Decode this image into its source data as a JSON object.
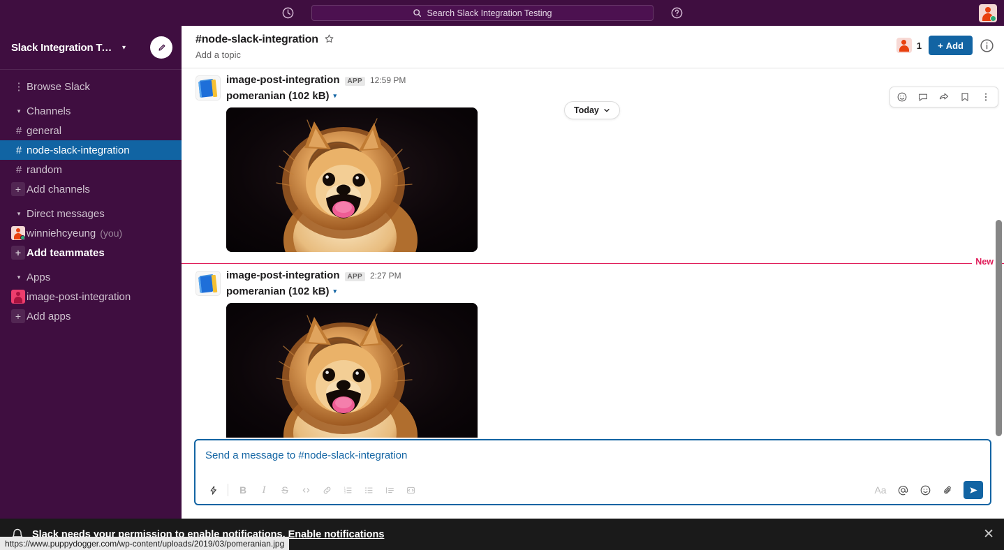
{
  "topbar": {
    "history_icon": "clock-icon",
    "search_placeholder": "Search Slack Integration Testing",
    "search_icon": "search-icon",
    "help_icon": "help-circle-icon",
    "avatar_icon": "user-avatar"
  },
  "sidebar": {
    "workspace_name": "Slack Integration Testi...",
    "workspace_caret": "▾",
    "compose_icon": "compose-pencil-icon",
    "browse": {
      "label": "Browse Slack",
      "glyph": "⋮"
    },
    "sections": [
      {
        "name": "channels",
        "label": "Channels",
        "caret": "▾",
        "items": [
          {
            "name": "general",
            "label": "general",
            "glyph": "#",
            "selected": false
          },
          {
            "name": "node-slack-integration",
            "label": "node-slack-integration",
            "glyph": "#",
            "selected": true
          },
          {
            "name": "random",
            "label": "random",
            "glyph": "#",
            "selected": false
          },
          {
            "name": "add-channels",
            "label": "Add channels",
            "glyph": "+",
            "selected": false
          }
        ]
      },
      {
        "name": "direct-messages",
        "label": "Direct messages",
        "caret": "▾",
        "items": [
          {
            "name": "winniehcyeung",
            "label": "winniehcyeung",
            "suffix": "(you)",
            "glyph": "avatar"
          },
          {
            "name": "add-teammates",
            "label": "Add teammates",
            "glyph": "+",
            "bold": true
          }
        ]
      },
      {
        "name": "apps",
        "label": "Apps",
        "caret": "▾",
        "items": [
          {
            "name": "image-post-integration",
            "label": "image-post-integration",
            "glyph": "app-avatar"
          },
          {
            "name": "add-apps",
            "label": "Add apps",
            "glyph": "+"
          }
        ]
      }
    ]
  },
  "channel_header": {
    "title": "#node-slack-integration",
    "star_icon": "star-outline-icon",
    "topic_placeholder": "Add a topic",
    "member_count": "1",
    "member_avatar_icon": "member-avatar-icon",
    "add_label": "+ Add",
    "add_plus": "+",
    "add_text": "Add",
    "info_icon": "info-circle-icon"
  },
  "messages": {
    "date_divider": {
      "label": "Today",
      "caret": "⌄"
    },
    "new_divider_label": "New",
    "hover_toolbar": [
      {
        "name": "add-reaction-icon",
        "glyph": "emoji"
      },
      {
        "name": "reply-in-thread-icon",
        "glyph": "thread"
      },
      {
        "name": "share-message-icon",
        "glyph": "share"
      },
      {
        "name": "save-message-icon",
        "glyph": "bookmark"
      },
      {
        "name": "more-actions-icon",
        "glyph": "kebab"
      }
    ],
    "items": [
      {
        "author": "image-post-integration",
        "app_badge": "APP",
        "time": "12:59 PM",
        "file_name": "pomeranian (102 kB)",
        "file_caret": "▾",
        "image_alt": "pomeranian-photo"
      },
      {
        "author": "image-post-integration",
        "app_badge": "APP",
        "time": "2:27 PM",
        "file_name": "pomeranian (102 kB)",
        "file_caret": "▾",
        "image_alt": "pomeranian-photo"
      }
    ]
  },
  "composer": {
    "placeholder": "Send a message to #node-slack-integration",
    "tools_left": [
      {
        "name": "shortcuts-lightning-icon",
        "label": "⚡",
        "active": true
      },
      {
        "name": "bold-icon",
        "label": "B"
      },
      {
        "name": "italic-icon",
        "label": "I"
      },
      {
        "name": "strikethrough-icon",
        "label": "S"
      },
      {
        "name": "code-icon",
        "label": "‹›"
      },
      {
        "name": "link-icon",
        "label": "🔗"
      },
      {
        "name": "ordered-list-icon",
        "label": "1≡"
      },
      {
        "name": "bulleted-list-icon",
        "label": "☰"
      },
      {
        "name": "blockquote-icon",
        "label": "≡"
      },
      {
        "name": "code-block-icon",
        "label": "⎙"
      }
    ],
    "tools_right": [
      {
        "name": "formatting-aa-icon",
        "label": "Aa"
      },
      {
        "name": "mention-icon",
        "label": "@"
      },
      {
        "name": "emoji-icon",
        "label": "☺"
      },
      {
        "name": "attach-file-icon",
        "label": "📎"
      }
    ],
    "send_icon": "send-icon"
  },
  "notification_bar": {
    "bell_icon": "bell-icon",
    "message": "Slack needs your permission to enable notifications.",
    "link": "Enable notifications",
    "close_icon": "close-icon"
  },
  "status_url": "https://www.puppydogger.com/wp-content/uploads/2019/03/pomeranian.jpg",
  "colors": {
    "sidebar_bg": "#3F0E40",
    "selected_channel": "#1164A3",
    "accent_blue": "#1264A3",
    "new_divider": "#E01E5A",
    "notif_bar": "#1A1A1A"
  }
}
